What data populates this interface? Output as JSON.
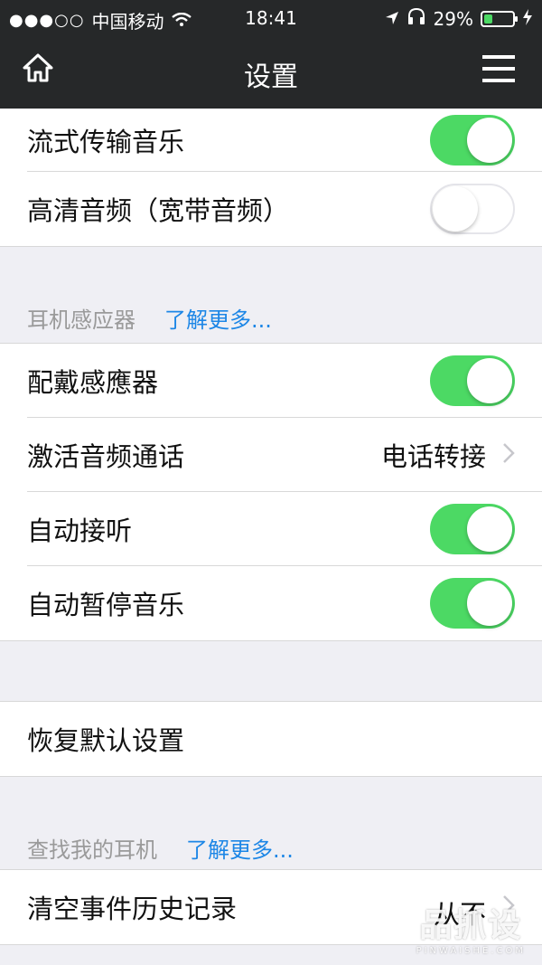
{
  "status_bar": {
    "carrier": "中国移动",
    "time": "18:41",
    "battery": "29%",
    "signal_dots": "●●●○○"
  },
  "nav": {
    "title": "设置"
  },
  "section1": {
    "rows": [
      {
        "label": "流式传输音乐",
        "toggle": "on"
      },
      {
        "label": "高清音频（宽带音频）",
        "toggle": "off"
      }
    ]
  },
  "section2": {
    "header": "耳机感应器",
    "link": "了解更多...",
    "rows": [
      {
        "label": "配戴感應器",
        "toggle": "on"
      },
      {
        "label": "激活音频通话",
        "value": "电话转接"
      },
      {
        "label": "自动接听",
        "toggle": "on"
      },
      {
        "label": "自动暂停音乐",
        "toggle": "on"
      }
    ]
  },
  "section3": {
    "rows": [
      {
        "label": "恢复默认设置"
      }
    ]
  },
  "section4": {
    "header": "查找我的耳机",
    "link": "了解更多...",
    "rows": [
      {
        "label": "清空事件历史记录",
        "value": "从不"
      }
    ]
  },
  "watermark": {
    "main": "品抓设",
    "sub": "PINWAISHE.COM"
  },
  "colors": {
    "bar_bg": "#262829",
    "switch_on": "#4cd964",
    "link": "#1c86e6",
    "page_bg": "#efeff4"
  }
}
